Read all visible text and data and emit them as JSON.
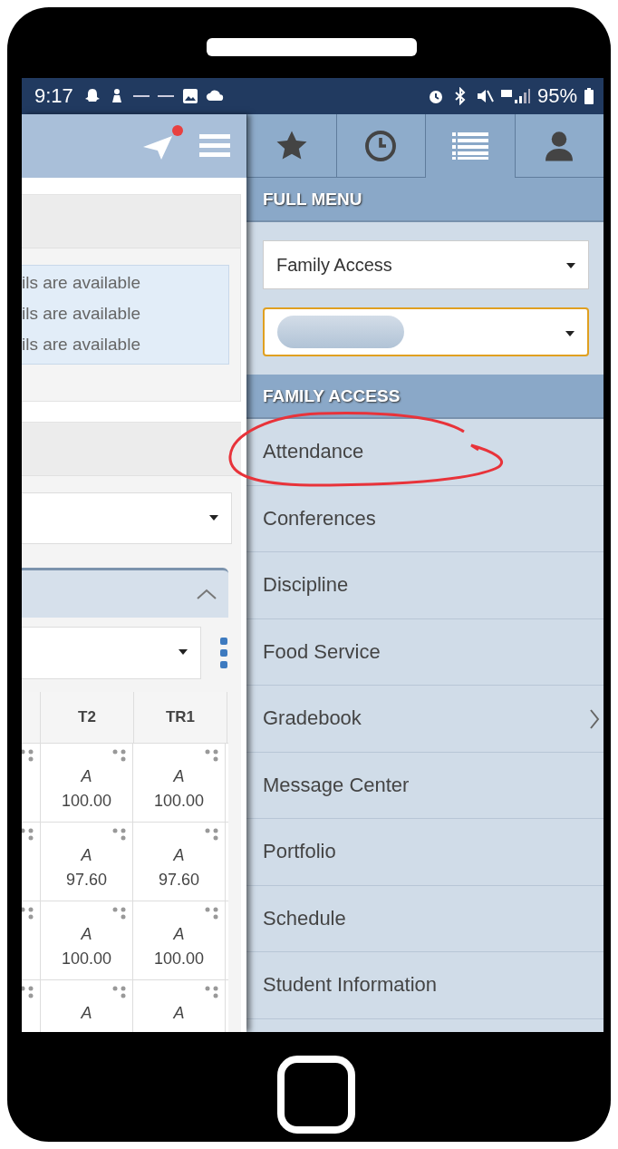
{
  "status_bar": {
    "time": "9:17",
    "battery": "95%"
  },
  "left_panel": {
    "notification_dot": true,
    "info_lines": [
      "ils are available",
      "ils are available",
      "ils are available"
    ],
    "grades_table": {
      "columns": [
        "T2",
        "TR1"
      ],
      "rows": [
        {
          "cells": [
            {
              "grade": "A",
              "score": "100.00"
            },
            {
              "grade": "A",
              "score": "100.00"
            }
          ]
        },
        {
          "cells": [
            {
              "grade": "A",
              "score": "97.60"
            },
            {
              "grade": "A",
              "score": "97.60"
            }
          ]
        },
        {
          "cells": [
            {
              "grade": "A",
              "score": "100.00"
            },
            {
              "grade": "A",
              "score": "100.00"
            }
          ]
        },
        {
          "cells": [
            {
              "grade": "A"
            },
            {
              "grade": "A"
            }
          ]
        }
      ]
    }
  },
  "menu": {
    "tabs": [
      {
        "kind": "star",
        "selected": false
      },
      {
        "kind": "clock",
        "selected": false
      },
      {
        "kind": "list",
        "selected": true
      },
      {
        "kind": "person",
        "selected": false
      }
    ],
    "full_menu_title": "FULL MENU",
    "module_select": {
      "value": "Family Access"
    },
    "student_select": {
      "highlighted": true
    },
    "section_title": "FAMILY ACCESS",
    "items": [
      {
        "label": "Attendance",
        "has_submenu": false,
        "circled": true
      },
      {
        "label": "Conferences",
        "has_submenu": false,
        "circled": false
      },
      {
        "label": "Discipline",
        "has_submenu": false,
        "circled": false
      },
      {
        "label": "Food Service",
        "has_submenu": false,
        "circled": false
      },
      {
        "label": "Gradebook",
        "has_submenu": true,
        "circled": false
      },
      {
        "label": "Message Center",
        "has_submenu": false,
        "circled": false
      },
      {
        "label": "Portfolio",
        "has_submenu": false,
        "circled": false
      },
      {
        "label": "Schedule",
        "has_submenu": false,
        "circled": false
      },
      {
        "label": "Student Information",
        "has_submenu": false,
        "circled": false
      }
    ]
  }
}
